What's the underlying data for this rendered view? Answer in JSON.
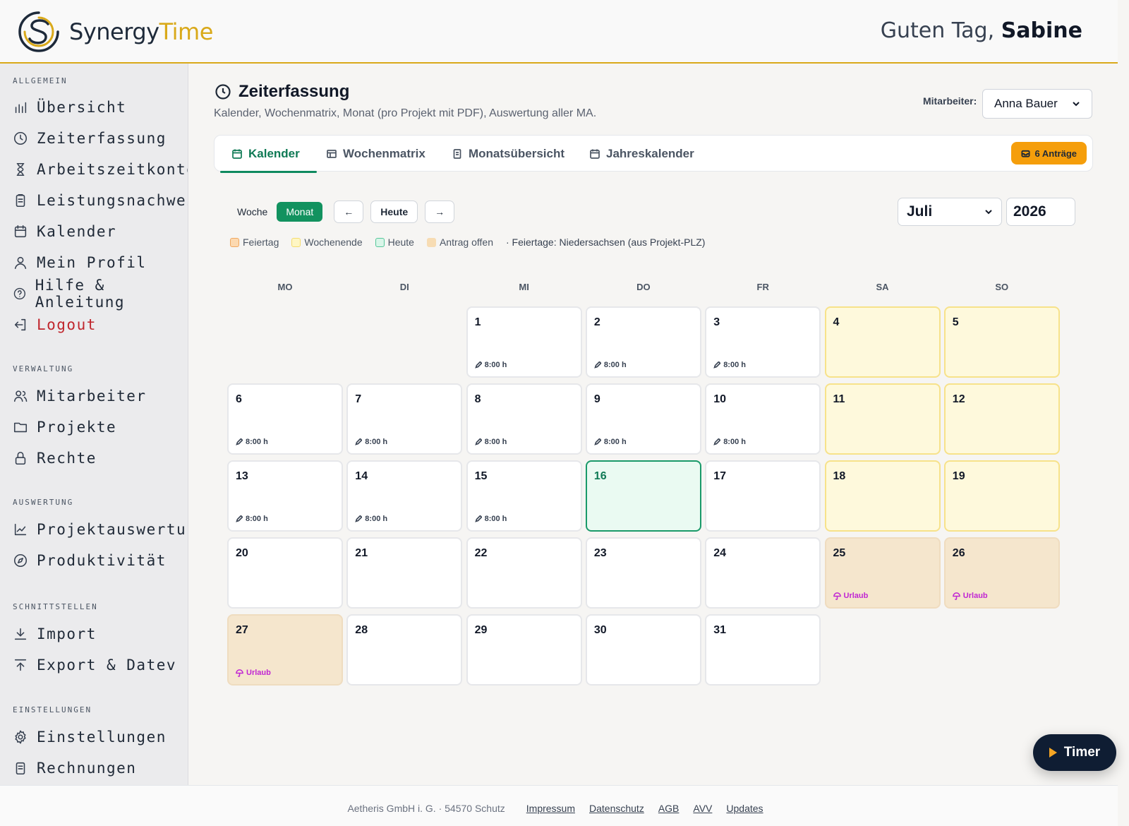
{
  "header": {
    "logo_part1": "Synergy",
    "logo_part2": "Time",
    "greeting_prefix": "Guten Tag,",
    "user_name": "Sabine"
  },
  "sidebar": {
    "sections": [
      {
        "title": "ALLGEMEIN",
        "items": [
          {
            "label": "Übersicht",
            "icon": "bar-chart-icon"
          },
          {
            "label": "Zeiterfassung",
            "icon": "clock-icon"
          },
          {
            "label": "Arbeitszeitkonto",
            "icon": "hourglass-icon"
          },
          {
            "label": "Leistungsnachweis",
            "icon": "clipboard-icon"
          },
          {
            "label": "Kalender",
            "icon": "calendar-icon"
          },
          {
            "label": "Mein Profil",
            "icon": "user-icon"
          },
          {
            "label": "Hilfe & Anleitung",
            "icon": "help-icon"
          },
          {
            "label": "Logout",
            "icon": "logout-icon"
          }
        ]
      },
      {
        "title": "VERWALTUNG",
        "items": [
          {
            "label": "Mitarbeiter",
            "icon": "users-icon"
          },
          {
            "label": "Projekte",
            "icon": "folder-icon"
          },
          {
            "label": "Rechte",
            "icon": "lock-icon"
          }
        ]
      },
      {
        "title": "AUSWERTUNG",
        "items": [
          {
            "label": "Projektauswertung",
            "icon": "line-chart-icon"
          },
          {
            "label": "Produktivität",
            "icon": "compass-icon"
          }
        ]
      },
      {
        "title": "SCHNITTSTELLEN",
        "items": [
          {
            "label": "Import",
            "icon": "download-icon"
          },
          {
            "label": "Export & Datev",
            "icon": "upload-icon"
          }
        ]
      },
      {
        "title": "EINSTELLUNGEN",
        "items": [
          {
            "label": "Einstellungen",
            "icon": "gear-icon"
          },
          {
            "label": "Rechnungen",
            "icon": "invoice-icon"
          }
        ]
      }
    ]
  },
  "page": {
    "title": "Zeiterfassung",
    "subtitle": "Kalender, Wochenmatrix, Monat (pro Projekt mit PDF), Auswertung aller MA.",
    "employee_label": "Mitarbeiter:",
    "employee_selected": "Anna Bauer"
  },
  "tabs": [
    {
      "label": "Kalender",
      "icon": "calendar-icon",
      "active": true
    },
    {
      "label": "Wochenmatrix",
      "icon": "table-icon",
      "active": false
    },
    {
      "label": "Monatsübersicht",
      "icon": "document-icon",
      "active": false
    },
    {
      "label": "Jahreskalender",
      "icon": "calendar-icon",
      "active": false
    }
  ],
  "requests_button": "6 Anträge",
  "controls": {
    "week": "Woche",
    "month": "Monat",
    "prev": "←",
    "today": "Heute",
    "next": "→",
    "month_selected": "Juli",
    "year": "2026"
  },
  "legend": {
    "items": [
      {
        "label": "Feiertag",
        "fill": "#fcd9b0",
        "border": "#f0a860"
      },
      {
        "label": "Wochenende",
        "fill": "#fef6c4",
        "border": "#f5dc6e"
      },
      {
        "label": "Heute",
        "fill": "#d9f5e8",
        "border": "#55c79a"
      },
      {
        "label": "Antrag offen",
        "fill": "#f7dcb3",
        "border": "#f7dcb3"
      }
    ],
    "note": "· Feiertage: Niedersachsen (aus Projekt-PLZ)"
  },
  "weekdays": [
    "MO",
    "DI",
    "MI",
    "DO",
    "FR",
    "SA",
    "SO"
  ],
  "calendar": {
    "first_weekday_index": 2,
    "days": [
      {
        "n": "1",
        "hours": "8:00 h",
        "type": "normal"
      },
      {
        "n": "2",
        "hours": "8:00 h",
        "type": "normal"
      },
      {
        "n": "3",
        "hours": "8:00 h",
        "type": "normal"
      },
      {
        "n": "4",
        "type": "weekend"
      },
      {
        "n": "5",
        "type": "weekend"
      },
      {
        "n": "6",
        "hours": "8:00 h",
        "type": "normal"
      },
      {
        "n": "7",
        "hours": "8:00 h",
        "type": "normal"
      },
      {
        "n": "8",
        "hours": "8:00 h",
        "type": "normal"
      },
      {
        "n": "9",
        "hours": "8:00 h",
        "type": "normal"
      },
      {
        "n": "10",
        "hours": "8:00 h",
        "type": "normal"
      },
      {
        "n": "11",
        "type": "weekend"
      },
      {
        "n": "12",
        "type": "weekend"
      },
      {
        "n": "13",
        "hours": "8:00 h",
        "type": "normal"
      },
      {
        "n": "14",
        "hours": "8:00 h",
        "type": "normal"
      },
      {
        "n": "15",
        "hours": "8:00 h",
        "type": "normal"
      },
      {
        "n": "16",
        "type": "today"
      },
      {
        "n": "17",
        "type": "normal"
      },
      {
        "n": "18",
        "type": "weekend"
      },
      {
        "n": "19",
        "type": "weekend"
      },
      {
        "n": "20",
        "type": "normal"
      },
      {
        "n": "21",
        "type": "normal"
      },
      {
        "n": "22",
        "type": "normal"
      },
      {
        "n": "23",
        "type": "normal"
      },
      {
        "n": "24",
        "type": "normal"
      },
      {
        "n": "25",
        "vacation": "Urlaub",
        "type": "vacation"
      },
      {
        "n": "26",
        "vacation": "Urlaub",
        "type": "vacation"
      },
      {
        "n": "27",
        "vacation": "Urlaub",
        "type": "vacation"
      },
      {
        "n": "28",
        "type": "normal"
      },
      {
        "n": "29",
        "type": "normal"
      },
      {
        "n": "30",
        "type": "normal"
      },
      {
        "n": "31",
        "type": "normal"
      }
    ]
  },
  "timer_label": "Timer",
  "footer": {
    "company": "Aetheris GmbH i. G. · 54570 Schutz",
    "links": [
      "Impressum",
      "Datenschutz",
      "AGB",
      "AVV",
      "Updates"
    ]
  }
}
